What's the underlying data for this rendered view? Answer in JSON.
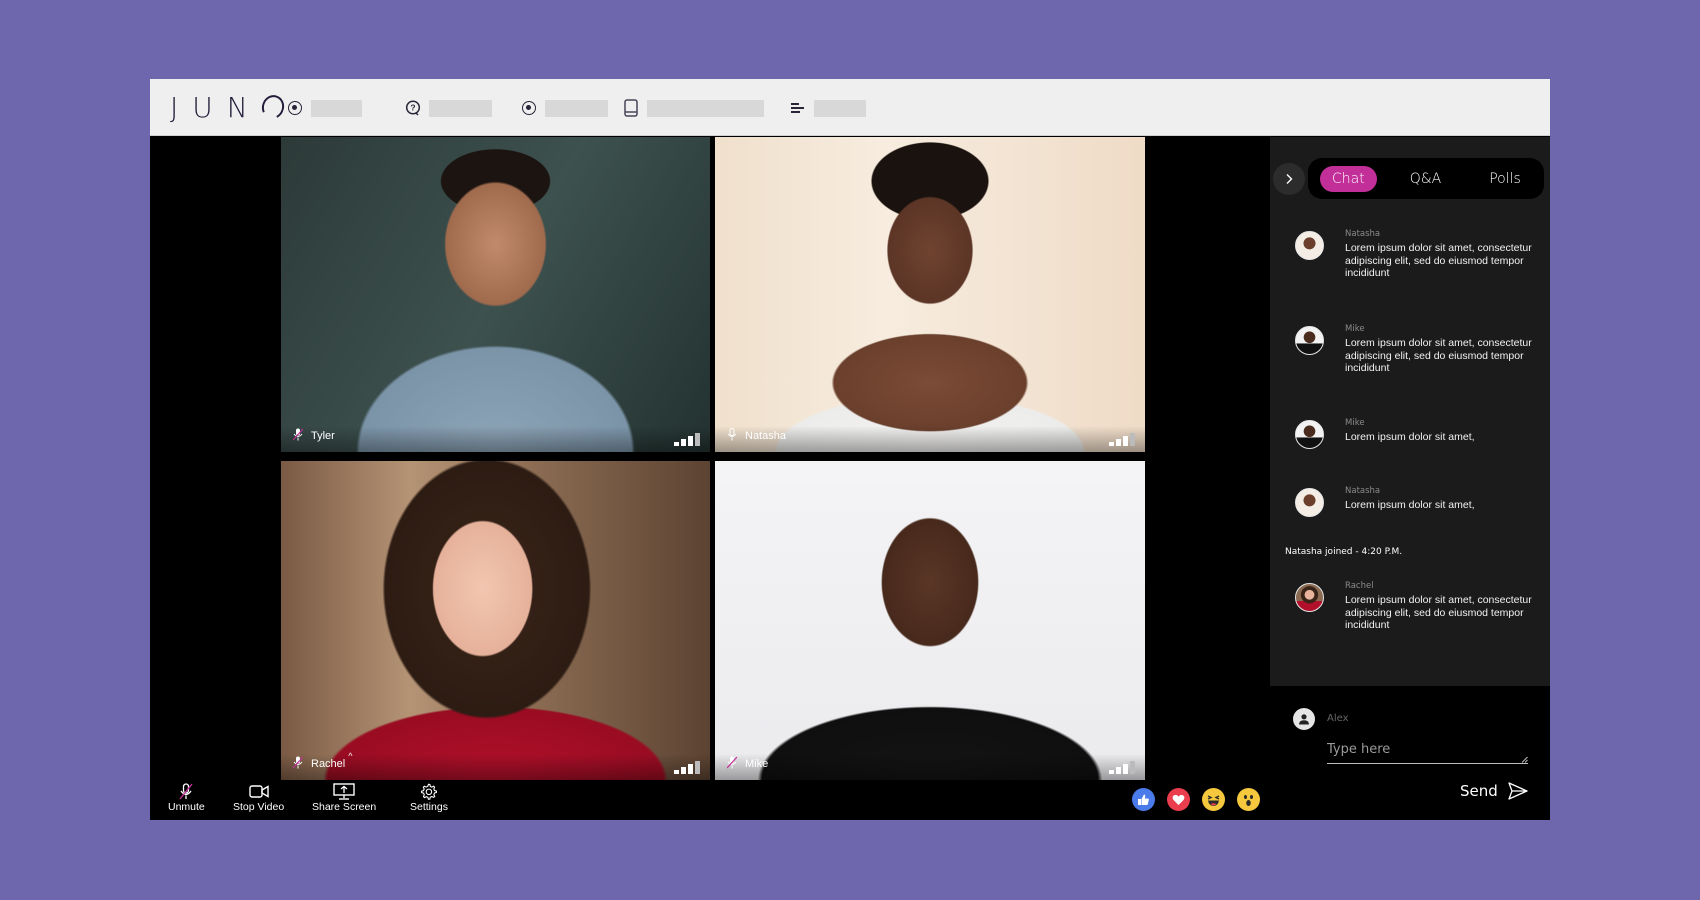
{
  "header": {
    "logo": "JUN",
    "nav": [
      {
        "icon": "radio-icon"
      },
      {
        "icon": "help-bubble-icon"
      },
      {
        "icon": "radio-icon"
      },
      {
        "icon": "book-icon"
      },
      {
        "icon": "align-left-icon"
      }
    ]
  },
  "tiles": [
    {
      "name": "Tyler",
      "muted": true
    },
    {
      "name": "Natasha",
      "muted": false
    },
    {
      "name": "Rachel",
      "muted": true,
      "extra": "^"
    },
    {
      "name": "Mike",
      "muted": true
    }
  ],
  "toolbar": {
    "unmute": "Unmute",
    "stop_video": "Stop Video",
    "share_screen": "Share Screen",
    "settings": "Settings"
  },
  "reactions": [
    "like",
    "love",
    "haha",
    "wow"
  ],
  "chat": {
    "tabs": [
      "Chat",
      "Q&A",
      "Polls"
    ],
    "active_tab": "Chat",
    "messages": [
      {
        "author": "Natasha",
        "text": "Lorem ipsum dolor sit amet, consectetur adipiscing elit, sed do eiusmod tempor incididunt"
      },
      {
        "author": "Mike",
        "text": "Lorem ipsum dolor sit amet, consectetur adipiscing elit, sed do eiusmod tempor incididunt"
      },
      {
        "author": "Mike",
        "text": "Lorem ipsum dolor sit amet,"
      },
      {
        "author": "Natasha",
        "text": "Lorem ipsum dolor sit amet,"
      },
      {
        "author": "Rachel",
        "text": "Lorem ipsum dolor sit amet, consectetur adipiscing elit, sed do eiusmod tempor incididunt"
      }
    ],
    "system_message": "Natasha joined - 4:20 P.M.",
    "compose": {
      "user": "Alex",
      "placeholder": "Type here",
      "value": "",
      "send_label": "Send"
    }
  },
  "colors": {
    "background": "#6f67ae",
    "accent": "#c22f99",
    "header": "#efefef",
    "chat_panel": "#1b1b1b"
  }
}
